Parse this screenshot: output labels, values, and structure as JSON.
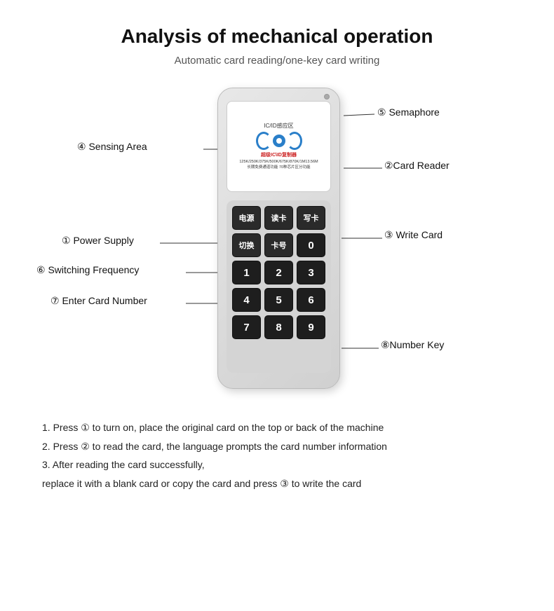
{
  "page": {
    "title": "Analysis of mechanical operation",
    "subtitle": "Automatic card reading/one-key card writing"
  },
  "annotations": {
    "item1": "① Power Supply",
    "item2": "②Card Reader",
    "item3": "③ Write Card",
    "item4": "④  Sensing Area",
    "item5": "⑤ Semaphore",
    "item6": "⑥ Switching Frequency",
    "item7": "⑦ Enter Card Number",
    "item8": "⑧Number Key"
  },
  "device": {
    "sensing_label": "IC/ID感应区",
    "title_line1": "超级IC\\ID复制器",
    "title_line2": "125K/250K/375K/500K/675K/870K/1M13.56M",
    "subtitle_line": "长期免费通道功能  70种芯片区分功能"
  },
  "keys": {
    "row1": [
      "电源",
      "读卡",
      "写卡"
    ],
    "row2": [
      "切换",
      "卡号",
      "0"
    ],
    "row3": [
      "1",
      "2",
      "3"
    ],
    "row4": [
      "4",
      "5",
      "6"
    ],
    "row5": [
      "7",
      "8",
      "9"
    ]
  },
  "instructions": [
    "1. Press ① to turn on, place the original card on the top or back of the machine",
    "2. Press ② to read the card, the language prompts the card number information",
    "3. After reading the card successfully,",
    "replace it with a blank card or copy the card and press ③ to write the card"
  ]
}
